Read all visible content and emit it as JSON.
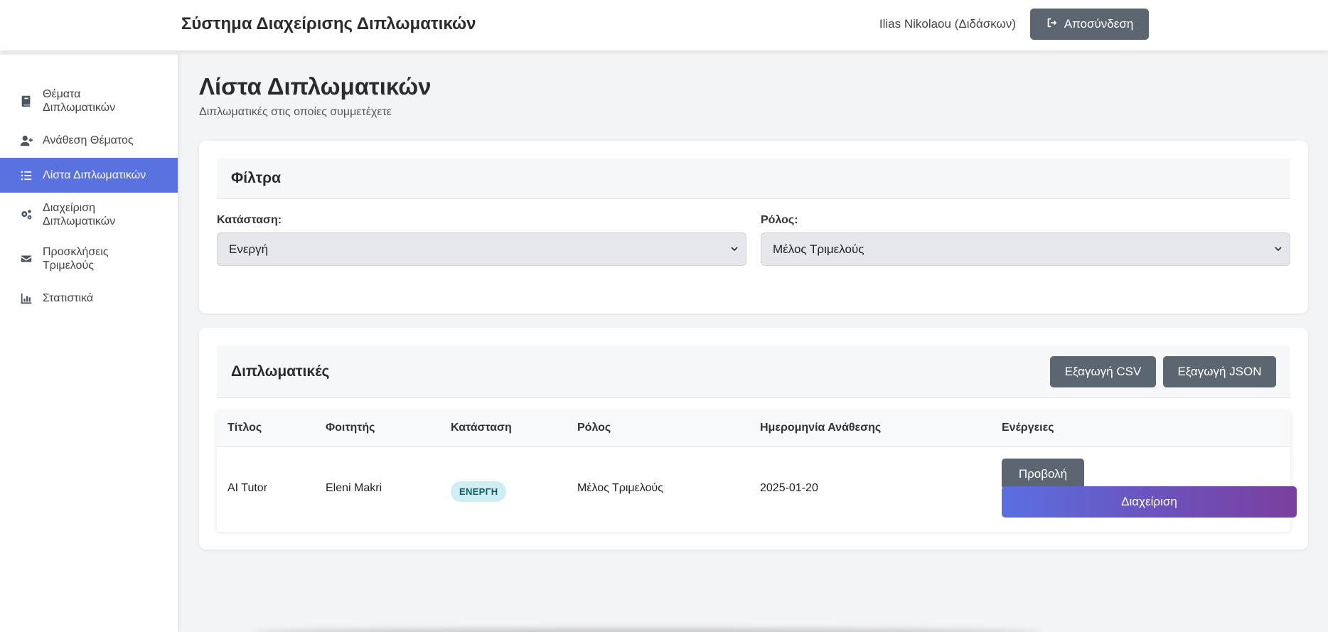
{
  "header": {
    "title": "Σύστημα Διαχείρισης Διπλωματικών",
    "user": "Ilias Nikolaou (Διδάσκων)",
    "logout_label": "Αποσύνδεση",
    "logout_icon": "logout-icon"
  },
  "sidebar": {
    "items": [
      {
        "label": "Θέματα Διπλωματικών",
        "icon": "book-icon",
        "active": false
      },
      {
        "label": "Ανάθεση Θέματος",
        "icon": "user-plus-icon",
        "active": false
      },
      {
        "label": "Λίστα Διπλωματικών",
        "icon": "list-icon",
        "active": true
      },
      {
        "label": "Διαχείριση Διπλωματικών",
        "icon": "gears-icon",
        "active": false
      },
      {
        "label": "Προσκλήσεις Τριμελούς",
        "icon": "envelope-icon",
        "active": false
      },
      {
        "label": "Στατιστικά",
        "icon": "chart-bar-icon",
        "active": false
      }
    ],
    "active_color": "#5a72e0"
  },
  "main": {
    "title": "Λίστα Διπλωματικών",
    "subtitle": "Διπλωματικές στις οποίες συμμετέχετε",
    "filters": {
      "title": "Φίλτρα",
      "status_label": "Κατάσταση:",
      "status_value": "Ενεργή",
      "role_label": "Ρόλος:",
      "role_value": "Μέλος Τριμελούς"
    },
    "list": {
      "title": "Διπλωματικές",
      "export_csv": "Εξαγωγή CSV",
      "export_json": "Εξαγωγή JSON",
      "columns": [
        "Τίτλος",
        "Φοιτητής",
        "Κατάσταση",
        "Ρόλος",
        "Ημερομηνία Ανάθεσης",
        "Ενέργειες"
      ],
      "rows": [
        {
          "title": "AI Tutor",
          "student": "Eleni Makri",
          "status": "ΕΝΕΡΓΗ",
          "role": "Μέλος Τριμελούς",
          "date": "2025-01-20",
          "view_label": "Προβολή",
          "manage_label": "Διαχείριση"
        }
      ]
    }
  },
  "colors": {
    "button_gray": "#5c6670",
    "badge_bg": "#cdeef2",
    "badge_text": "#0e5d68",
    "gradient_start": "#5a6fe0",
    "gradient_end": "#7b3f9e"
  }
}
